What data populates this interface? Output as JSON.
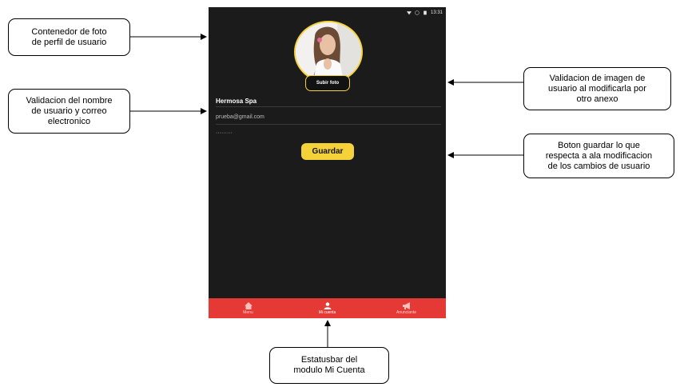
{
  "callouts": {
    "photo_container": "Contenedor de foto\nde perfil de usuario",
    "name_validation": "Validacion del nombre\nde usuario y correo\nelectronico",
    "image_validation": "Validacion de imagen de\nusuario al modificarla por\notro anexo",
    "save_button": "Boton guardar lo que\nrespecta a ala modificacion\nde los cambios de usuario",
    "statusbar": "Estatusbar del\nmodulo Mi Cuenta"
  },
  "phone": {
    "status_time": "13:31",
    "upload_label": "Subir foto",
    "username": "Hermosa Spa",
    "email": "prueba@gmail.com",
    "password_mask": "·········",
    "save_label": "Guardar",
    "tabs": [
      {
        "label": "Menu",
        "icon": "home-icon"
      },
      {
        "label": "Mi cuenta",
        "icon": "user-icon"
      },
      {
        "label": "Anunciante",
        "icon": "megaphone-icon"
      }
    ]
  },
  "colors": {
    "accent": "#f6d23a",
    "tabbar": "#e53935",
    "phone_bg": "#1b1b1b"
  }
}
